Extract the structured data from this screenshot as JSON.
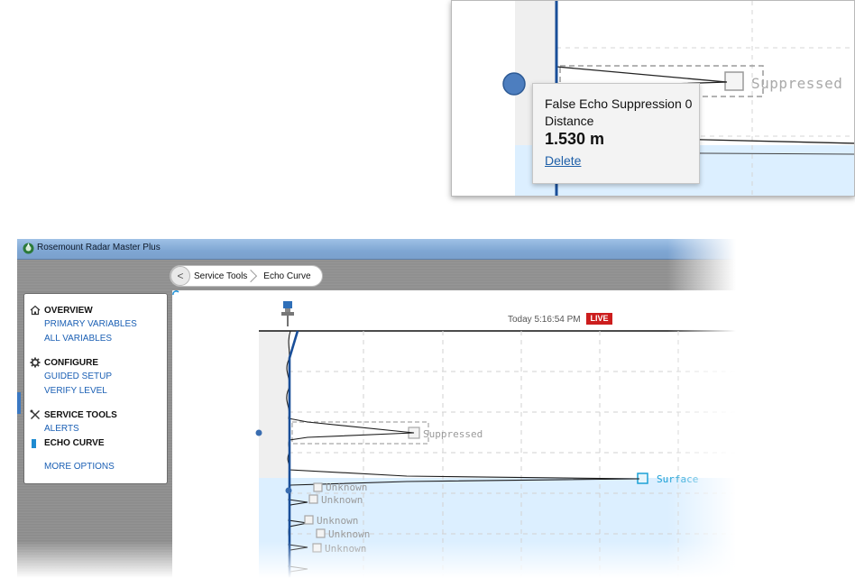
{
  "zoom": {
    "suppressed_label": "Suppressed",
    "tooltip": {
      "title": "False Echo Suppression 0",
      "label": "Distance",
      "value": "1.530 m",
      "action": "Delete"
    }
  },
  "window": {
    "title": "Rosemount Radar Master Plus",
    "breadcrumb": {
      "back": "<",
      "items": [
        "Service Tools",
        "Echo Curve"
      ]
    }
  },
  "sidebar": {
    "sections": [
      {
        "heading": "OVERVIEW",
        "icon": "home-icon",
        "items": [
          "PRIMARY VARIABLES",
          "ALL VARIABLES"
        ]
      },
      {
        "heading": "CONFIGURE",
        "icon": "gear-icon",
        "items": [
          "GUIDED SETUP",
          "VERIFY LEVEL"
        ]
      },
      {
        "heading": "SERVICE TOOLS",
        "icon": "tools-icon",
        "items": [
          "ALERTS",
          "ECHO CURVE"
        ]
      }
    ],
    "more": "MORE OPTIONS"
  },
  "echo_view": {
    "timestamp": "Today 5:16:54 PM",
    "live": "LIVE",
    "suppressed_label": "Suppressed",
    "surface_label": "Surface",
    "unknown_labels": [
      "Unknown",
      "Unknown",
      "Unknown",
      "Unknown",
      "Unknown"
    ]
  },
  "colors": {
    "accent": "#1a5fb4",
    "live": "#cc1d1d",
    "surface": "#1ca1d6",
    "product_fill": "#dcefff"
  }
}
